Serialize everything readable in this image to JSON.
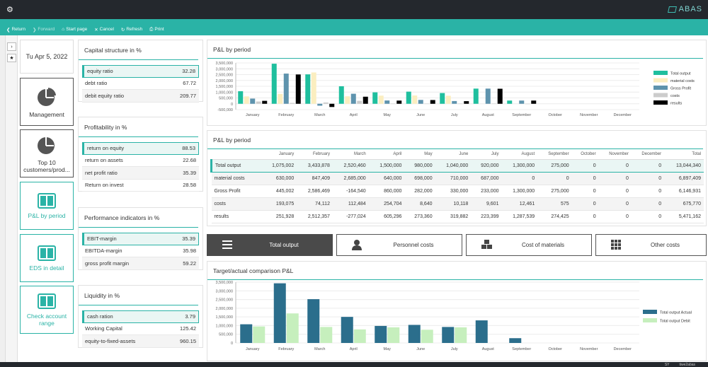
{
  "app": {
    "brand": "ABAS"
  },
  "toolbar": {
    "return": "Return",
    "forward": "Forward",
    "start_page": "Start page",
    "cancel": "Cancel",
    "refresh": "Refresh",
    "print": "Print"
  },
  "nav": {
    "date": "Tu Apr 5, 2022",
    "tiles": [
      "Management",
      "Top 10 customers/prod...",
      "P&L by period",
      "EDS in detail",
      "Check account range"
    ]
  },
  "capital": {
    "title": "Capital structure in %",
    "rows": [
      {
        "label": "equity ratio",
        "value": "32.28"
      },
      {
        "label": "debt ratio",
        "value": "67.72"
      },
      {
        "label": "debit equity ratio",
        "value": "209.77"
      }
    ]
  },
  "profitability": {
    "title": "Profitability in %",
    "rows": [
      {
        "label": "return on equity",
        "value": "88.53"
      },
      {
        "label": "return on assets",
        "value": "22.68"
      },
      {
        "label": "net profit ratio",
        "value": "35.39"
      },
      {
        "label": "Return on invest",
        "value": "28.58"
      }
    ]
  },
  "performance": {
    "title": "Performance indicators in %",
    "rows": [
      {
        "label": "EBIT-margin",
        "value": "35.39"
      },
      {
        "label": "EBITDA-margin",
        "value": "35.98"
      },
      {
        "label": "gross profit margin",
        "value": "59.22"
      }
    ]
  },
  "liquidity": {
    "title": "Liquidity in %",
    "rows": [
      {
        "label": "cash ration",
        "value": "3.79"
      },
      {
        "label": "Working Capital",
        "value": "125.42"
      },
      {
        "label": "equity-to-fixed-assets",
        "value": "960.15"
      }
    ]
  },
  "pl_chart": {
    "title": "P&L by period"
  },
  "pl_table": {
    "title": "P&L by period",
    "headers": [
      "",
      "January",
      "February",
      "March",
      "April",
      "May",
      "June",
      "July",
      "August",
      "September",
      "October",
      "November",
      "December",
      "Total"
    ],
    "rows": [
      [
        "Total output",
        "1,075,002",
        "3,433,878",
        "2,520,460",
        "1,500,000",
        "980,000",
        "1,040,000",
        "920,000",
        "1,300,000",
        "275,000",
        "0",
        "0",
        "0",
        "13,044,340"
      ],
      [
        "material costs",
        "630,000",
        "847,409",
        "2,685,000",
        "640,000",
        "698,000",
        "710,000",
        "687,000",
        "0",
        "0",
        "0",
        "0",
        "0",
        "6,897,409"
      ],
      [
        "Gross Profit",
        "445,002",
        "2,586,469",
        "-164,540",
        "860,000",
        "282,000",
        "330,000",
        "233,000",
        "1,300,000",
        "275,000",
        "0",
        "0",
        "0",
        "6,146,931"
      ],
      [
        "costs",
        "193,075",
        "74,112",
        "112,484",
        "254,704",
        "8,640",
        "10,118",
        "9,601",
        "12,461",
        "575",
        "0",
        "0",
        "0",
        "675,770"
      ],
      [
        "results",
        "251,928",
        "2,512,357",
        "-277,024",
        "605,296",
        "273,360",
        "319,882",
        "223,399",
        "1,287,539",
        "274,425",
        "0",
        "0",
        "0",
        "5,471,162"
      ]
    ]
  },
  "tabs": [
    "Total output",
    "Personnel costs",
    "Cost of materials",
    "Other costs"
  ],
  "target_chart": {
    "title": "Target/actual comparison P&L"
  },
  "status": {
    "left": "SY",
    "right": "tiwe2abas"
  },
  "colors": {
    "accent": "#2ab3a6",
    "total_output": "#1fbf9e",
    "material_costs": "#fbeec0",
    "gross_profit": "#5e93ad",
    "costs": "#cccccc",
    "results": "#000000",
    "actual": "#2b6e8c",
    "debit": "#c6efbd"
  },
  "chart_data": [
    {
      "type": "bar",
      "categories": [
        "January",
        "February",
        "March",
        "April",
        "May",
        "June",
        "July",
        "August",
        "September",
        "October",
        "November",
        "December"
      ],
      "series": [
        {
          "name": "Total output",
          "values": [
            1075002,
            3433878,
            2520460,
            1500000,
            980000,
            1040000,
            920000,
            1300000,
            275000,
            0,
            0,
            0
          ]
        },
        {
          "name": "material costs",
          "values": [
            630000,
            847409,
            2685000,
            640000,
            698000,
            710000,
            687000,
            0,
            0,
            0,
            0,
            0
          ]
        },
        {
          "name": "Gross Profit",
          "values": [
            445002,
            2586469,
            -164540,
            860000,
            282000,
            330000,
            233000,
            1300000,
            275000,
            0,
            0,
            0
          ]
        },
        {
          "name": "costs",
          "values": [
            193075,
            74112,
            112484,
            254704,
            8640,
            10118,
            9601,
            12461,
            575,
            0,
            0,
            0
          ]
        },
        {
          "name": "results",
          "values": [
            251928,
            2512357,
            -277024,
            605296,
            273360,
            319882,
            223399,
            1287539,
            274425,
            0,
            0,
            0
          ]
        }
      ],
      "yticks": [
        "3,500,000",
        "3,000,000",
        "2,500,000",
        "2,000,000",
        "1,500,000",
        "1,000,000",
        "500,000",
        "0",
        "-500,000"
      ],
      "ylim": [
        -500000,
        3500000
      ],
      "grid": true,
      "legend": "right"
    },
    {
      "type": "bar",
      "categories": [
        "January",
        "February",
        "March",
        "April",
        "May",
        "June",
        "July",
        "August",
        "September",
        "October",
        "November",
        "December"
      ],
      "series": [
        {
          "name": "Total output Actual",
          "values": [
            1075002,
            3433878,
            2520460,
            1500000,
            980000,
            1040000,
            920000,
            1300000,
            275000,
            0,
            0,
            0
          ]
        },
        {
          "name": "Total output Debit",
          "values": [
            950000,
            1700000,
            920000,
            780000,
            900000,
            760000,
            900000,
            0,
            0,
            0,
            0,
            0
          ]
        }
      ],
      "yticks": [
        "3,500,000",
        "3,000,000",
        "2,500,000",
        "2,000,000",
        "1,500,000",
        "1,000,000",
        "500,000",
        "0"
      ],
      "ylim": [
        0,
        3500000
      ],
      "grid": true,
      "legend": "right"
    }
  ]
}
